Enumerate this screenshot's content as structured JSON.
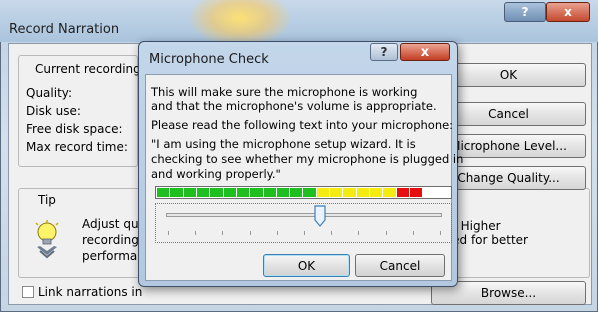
{
  "record_narration": {
    "title": "Record Narration",
    "help_glyph": "?",
    "close_glyph": "x",
    "current_recording_label": "Current recording",
    "stats": [
      "Quality:",
      "Disk use:",
      "Free disk space:",
      "Max record time:"
    ],
    "buttons": {
      "ok": "OK",
      "cancel": "Cancel",
      "mic_level": "Microphone Level...",
      "change_quality": "Change Quality...",
      "browse": "Browse..."
    },
    "tip": {
      "label": "Tip",
      "icon": "lightbulb-tip-icon",
      "left_lines": [
        "Adjust qua",
        "recording",
        "performar"
      ],
      "right_lines": [
        "ge. Higher",
        "nked for better"
      ]
    },
    "link_checkbox": {
      "label": "Link narrations in",
      "checked": false
    }
  },
  "mic_check": {
    "title": "Microphone Check",
    "help_glyph": "?",
    "close_glyph": "x",
    "intro_lines": [
      "This will make sure the microphone is working",
      "and that the microphone's volume is appropriate."
    ],
    "instruction": "Please read the following text into your microphone:",
    "quote_lines": [
      "\"I am using the microphone setup wizard. It is",
      "checking to see whether my microphone is plugged in",
      "and working properly.\""
    ],
    "meter": {
      "green_segments": 12,
      "yellow_segments": 6,
      "red_segments": 2,
      "empty_segments": 2,
      "colors": {
        "green": "#1fbf1f",
        "yellow": "#f4ec10",
        "red": "#e60e0e",
        "empty": "#ffffff"
      }
    },
    "slider": {
      "level_percent": 56
    },
    "buttons": {
      "ok": "OK",
      "cancel": "Cancel"
    }
  }
}
